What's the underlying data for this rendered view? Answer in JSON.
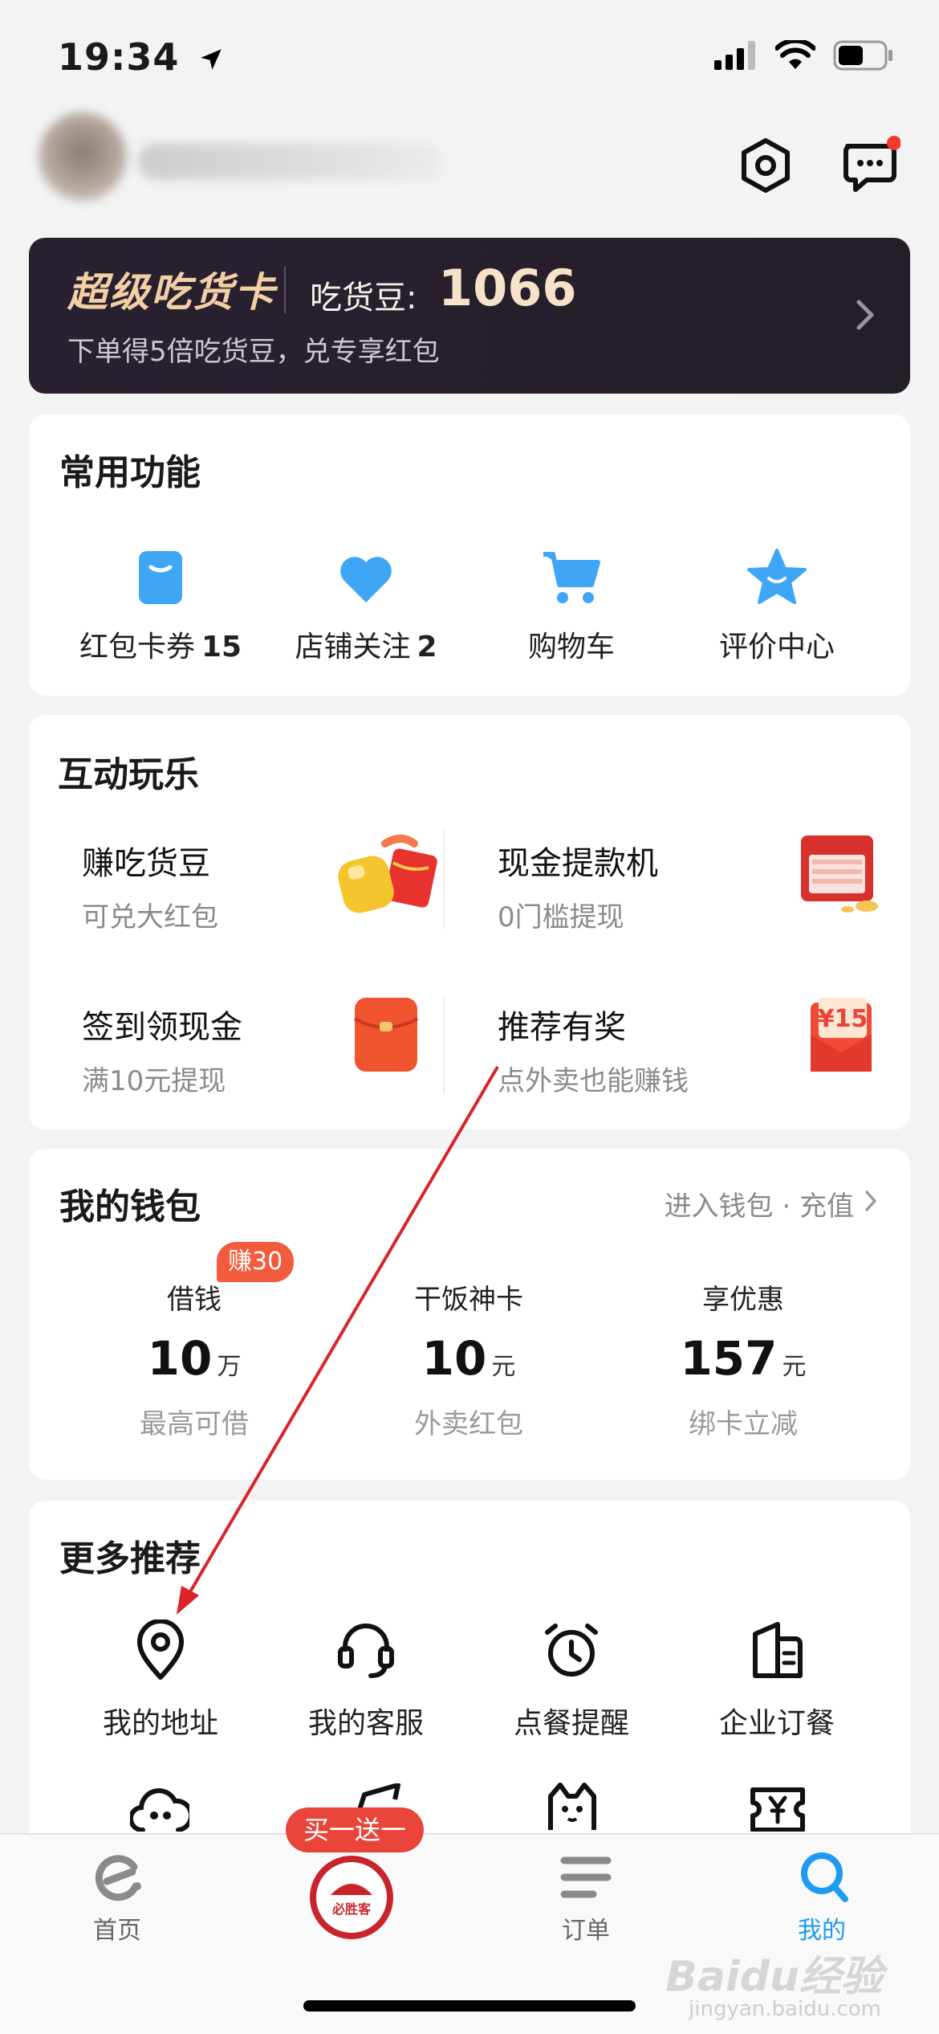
{
  "status_bar": {
    "time": "19:34"
  },
  "super_card": {
    "title": "超级吃货卡",
    "beans_label": "吃货豆:",
    "beans_value": "1066",
    "subtitle": "下单得5倍吃货豆，兑专享红包"
  },
  "common_functions": {
    "title": "常用功能",
    "items": [
      {
        "label": "红包卡券",
        "count": "15",
        "icon": "coupon-icon"
      },
      {
        "label": "店铺关注",
        "count": "2",
        "icon": "heart-icon"
      },
      {
        "label": "购物车",
        "count": "",
        "icon": "cart-icon"
      },
      {
        "label": "评价中心",
        "count": "",
        "icon": "star-icon"
      }
    ]
  },
  "games": {
    "title": "互动玩乐",
    "items": [
      {
        "title": "赚吃货豆",
        "subtitle": "可兑大红包",
        "icon": "bean-giftbox-icon"
      },
      {
        "title": "现金提款机",
        "subtitle": "0门槛提现",
        "icon": "atm-icon"
      },
      {
        "title": "签到领现金",
        "subtitle": "满10元提现",
        "icon": "red-envelope-icon"
      },
      {
        "title": "推荐有奖",
        "subtitle": "点外卖也能赚钱",
        "icon": "referral-envelope-icon",
        "badge": "¥15"
      }
    ]
  },
  "wallet": {
    "title": "我的钱包",
    "link": "进入钱包 · 充值",
    "items": [
      {
        "label": "借钱",
        "value": "10",
        "unit": "万",
        "subtitle": "最高可借",
        "badge": "赚30"
      },
      {
        "label": "干饭神卡",
        "value": "10",
        "unit": "元",
        "subtitle": "外卖红包"
      },
      {
        "label": "享优惠",
        "value": "157",
        "unit": "元",
        "subtitle": "绑卡立减"
      }
    ]
  },
  "more": {
    "title": "更多推荐",
    "items": [
      {
        "label": "我的地址",
        "icon": "location-pin-icon"
      },
      {
        "label": "我的客服",
        "icon": "headset-icon"
      },
      {
        "label": "点餐提醒",
        "icon": "alarm-clock-icon"
      },
      {
        "label": "企业订餐",
        "icon": "building-icon"
      }
    ]
  },
  "tabbar": {
    "home": "首页",
    "promo_badge": "买一送一",
    "promo_logo": "必胜客",
    "orders": "订单",
    "mine": "我的"
  },
  "watermark": {
    "text": "Baidu经验",
    "sub": "jingyan.baidu.com"
  },
  "colors": {
    "accent_blue": "#1e9bf0",
    "promo_red": "#e8443a",
    "card_dark": "#2a2130"
  }
}
